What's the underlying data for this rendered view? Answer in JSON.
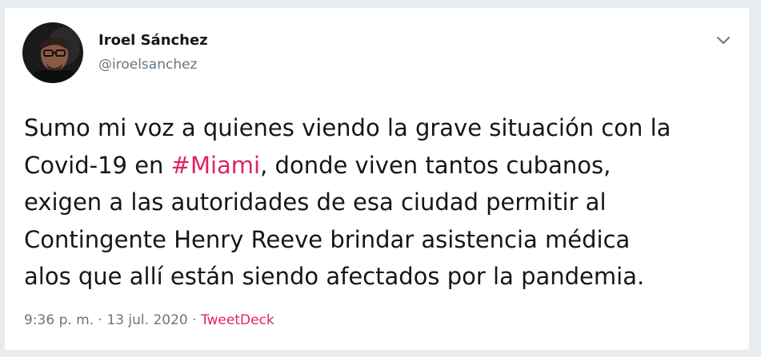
{
  "author": {
    "name": "Iroel Sánchez",
    "handle": "@iroelsanchez"
  },
  "tweet": {
    "line1": "Sumo mi voz a quienes viendo la grave situación con la",
    "line2_before": "Covid-19 en ",
    "hashtag": "#Miami",
    "line2_after": ", donde viven tantos cubanos,",
    "line3": "exigen a las autoridades de esa ciudad permitir al",
    "line4": "Contingente Henry Reeve brindar  asistencia médica",
    "line5": "alos que allí están siendo afectados por la pandemia."
  },
  "meta": {
    "time": "9:36 p. m.",
    "separator1": " · ",
    "date": "13 jul. 2020",
    "separator2": " · ",
    "source": "TweetDeck"
  },
  "colors": {
    "accent": "#e0245e",
    "text": "#14171a",
    "secondary": "#657786"
  },
  "icons": {
    "menu": "chevron-down-icon",
    "avatar": "avatar"
  }
}
